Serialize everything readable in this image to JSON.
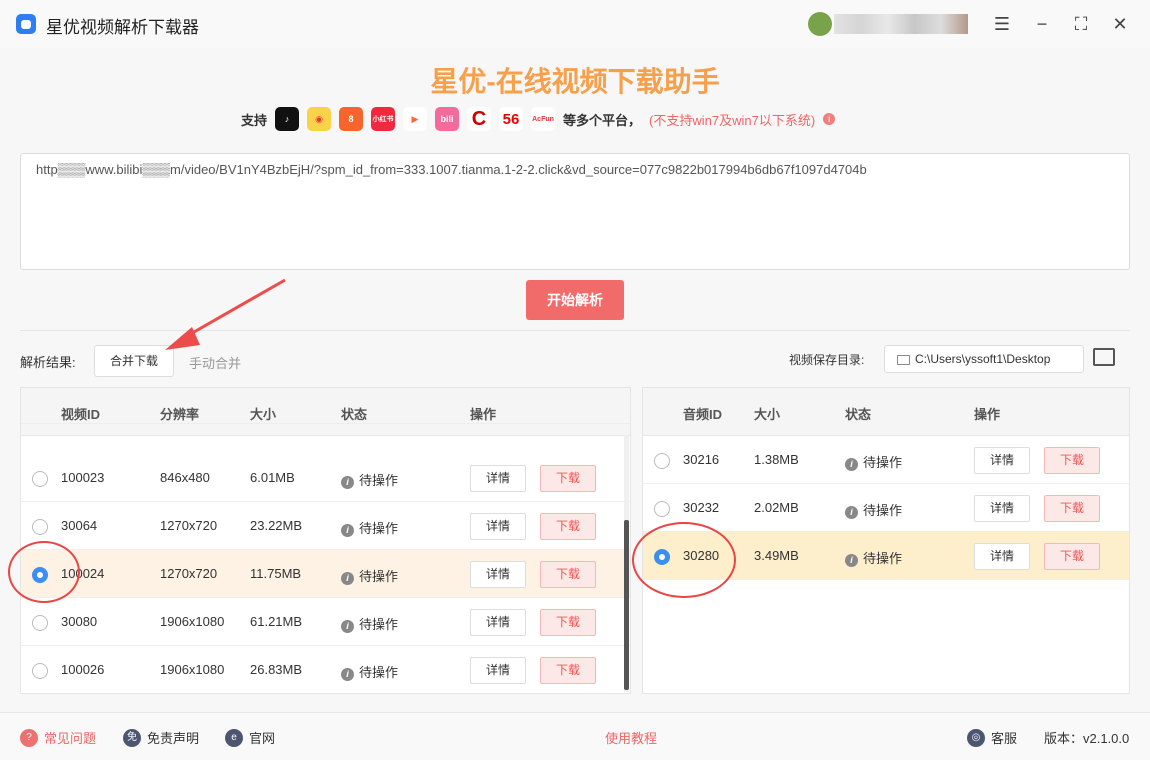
{
  "window": {
    "title": "星优视频解析下载器",
    "controls": [
      "settings",
      "minimize",
      "maximize",
      "close"
    ]
  },
  "header": {
    "title": "星优-在线视频下载助手",
    "support_label": "支持",
    "platforms": [
      "抖音",
      "微博",
      "快手",
      "小红书",
      "腾讯视频",
      "哔哩哔哩",
      "CCTV",
      "56",
      "AcFun"
    ],
    "platforms_suffix": "等多个平台，",
    "warning": "(不支持win7及win7以下系统)"
  },
  "url_input": {
    "value": "http▒▒▒www.bilibi▒▒▒m/video/BV1nY4BzbEjH/?spm_id_from=333.1007.tianma.1-2-2.click&vd_source=077c9822b017994b6db67f1097d4704b"
  },
  "parse_button": "开始解析",
  "results": {
    "label": "解析结果:",
    "merge_tab": "合并下载",
    "manual_tab": "手动合并",
    "save_dir_label": "视频保存目录:",
    "save_dir": "C:\\Users\\yssoft1\\Desktop"
  },
  "video_table": {
    "headers": [
      "视频ID",
      "分辨率",
      "大小",
      "状态",
      "操作"
    ],
    "rows": [
      {
        "id": "100023",
        "res": "846x480",
        "size": "6.01MB",
        "status": "待操作",
        "selected": false
      },
      {
        "id": "30064",
        "res": "1270x720",
        "size": "23.22MB",
        "status": "待操作",
        "selected": false
      },
      {
        "id": "100024",
        "res": "1270x720",
        "size": "11.75MB",
        "status": "待操作",
        "selected": true
      },
      {
        "id": "30080",
        "res": "1906x1080",
        "size": "61.21MB",
        "status": "待操作",
        "selected": false
      },
      {
        "id": "100026",
        "res": "1906x1080",
        "size": "26.83MB",
        "status": "待操作",
        "selected": false
      }
    ],
    "detail_label": "详情",
    "download_label": "下载"
  },
  "audio_table": {
    "headers": [
      "音频ID",
      "大小",
      "状态",
      "操作"
    ],
    "rows": [
      {
        "id": "30216",
        "size": "1.38MB",
        "status": "待操作",
        "selected": false
      },
      {
        "id": "30232",
        "size": "2.02MB",
        "status": "待操作",
        "selected": false
      },
      {
        "id": "30280",
        "size": "3.49MB",
        "status": "待操作",
        "selected": true
      }
    ]
  },
  "footer": {
    "faq": "常见问题",
    "disclaimer": "免责声明",
    "website": "官网",
    "tutorial": "使用教程",
    "service": "客服",
    "version": "版本：v2.1.0.0"
  },
  "colors": {
    "accent": "#f26b6b",
    "heading": "#f7a04b",
    "radio": "#3b8ff0"
  }
}
